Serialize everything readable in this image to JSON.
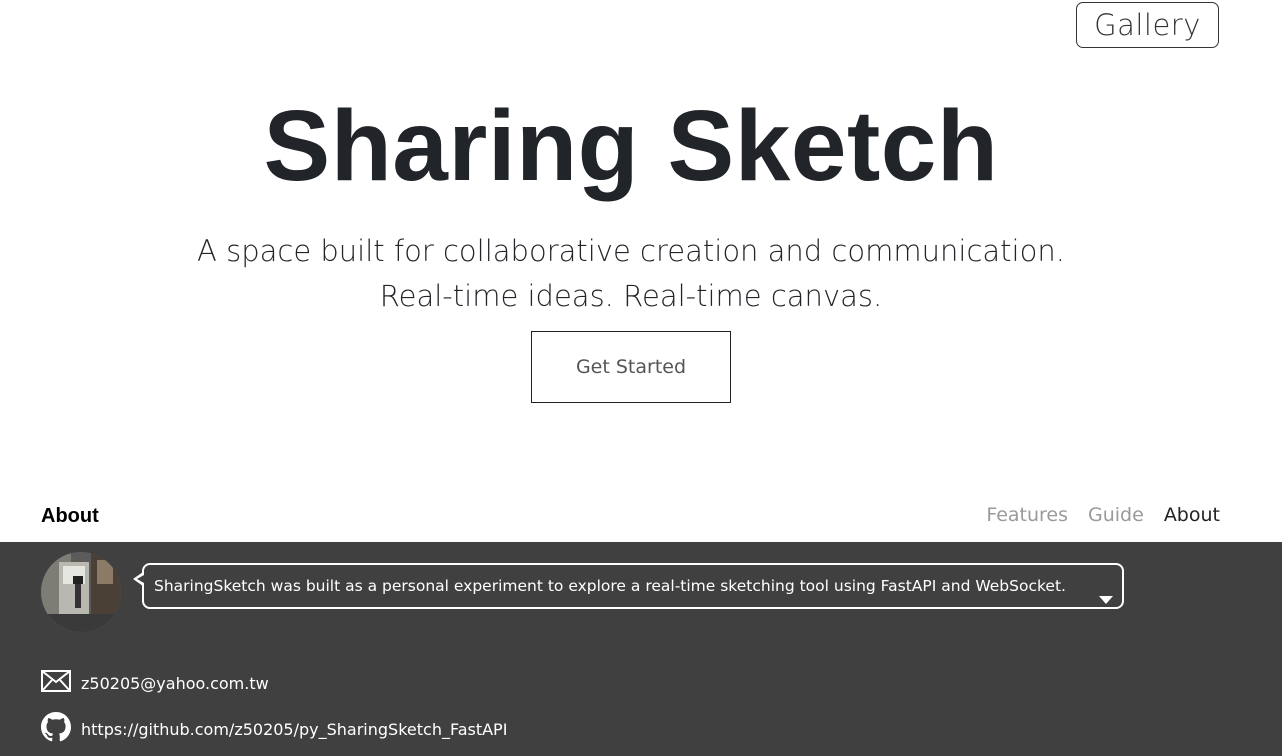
{
  "header": {
    "gallery_label": "Gallery"
  },
  "hero": {
    "title": "Sharing Sketch",
    "tagline_line1": "A space built for collaborative creation and communication.",
    "tagline_line2": "Real-time ideas. Real-time canvas.",
    "cta_label": "Get Started"
  },
  "section": {
    "label": "About",
    "nav": [
      {
        "label": "Features",
        "active": false
      },
      {
        "label": "Guide",
        "active": false
      },
      {
        "label": "About",
        "active": true
      }
    ]
  },
  "about": {
    "message": "SharingSketch was built as a personal experiment to explore a real-time sketching tool using FastAPI and WebSocket.",
    "email": "z50205@yahoo.com.tw",
    "github": "https://github.com/z50205/py_SharingSketch_FastAPI",
    "panel_color": "#404040",
    "icons": [
      "envelope-icon",
      "github-icon",
      "expand-caret-icon"
    ]
  }
}
